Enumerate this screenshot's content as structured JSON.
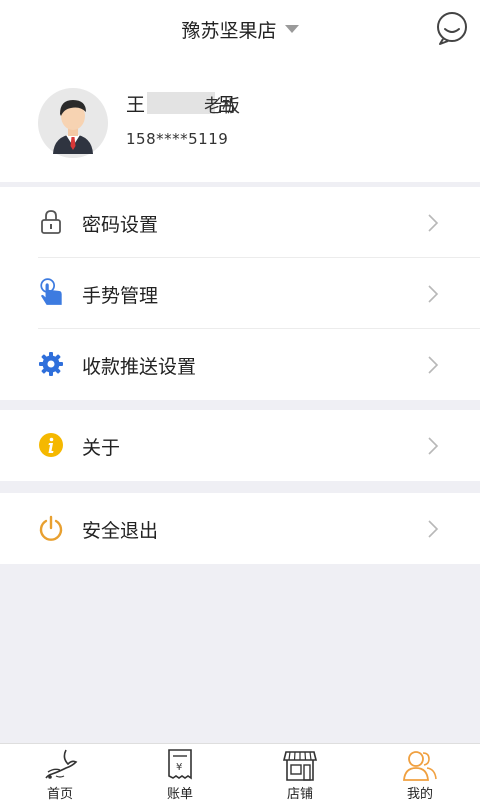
{
  "header": {
    "store_name": "豫苏坚果店"
  },
  "profile": {
    "name_first": "王",
    "name_last": "吕",
    "role": "老板",
    "phone": "158****5119"
  },
  "menu_group_1": [
    {
      "label": "密码设置",
      "icon": "lock-icon"
    },
    {
      "label": "手势管理",
      "icon": "gesture-hand-icon"
    },
    {
      "label": "收款推送设置",
      "icon": "gear-icon"
    }
  ],
  "menu_group_2": [
    {
      "label": "关于",
      "icon": "info-icon"
    }
  ],
  "menu_group_3": [
    {
      "label": "安全退出",
      "icon": "power-icon"
    }
  ],
  "tabs": [
    {
      "label": "首页",
      "icon": "home-bird-icon"
    },
    {
      "label": "账单",
      "icon": "receipt-icon"
    },
    {
      "label": "店铺",
      "icon": "store-icon"
    },
    {
      "label": "我的",
      "icon": "user-icon",
      "active": true
    }
  ],
  "colors": {
    "accent_orange": "#f0a040",
    "icon_blue": "#3d7be0",
    "info_yellow": "#f5b800",
    "background": "#efeff4"
  }
}
